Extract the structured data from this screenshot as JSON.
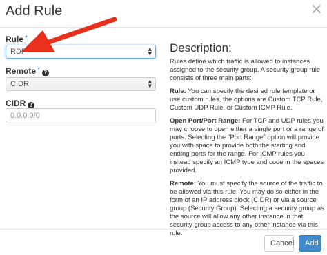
{
  "dialog": {
    "title": "Add Rule",
    "close_glyph": "×"
  },
  "form": {
    "rule": {
      "label": "Rule",
      "required_mark": "*",
      "value": "RDP"
    },
    "remote": {
      "label": "Remote",
      "required_mark": "*",
      "help_glyph": "?",
      "value": "CIDR"
    },
    "cidr": {
      "label": "CIDR",
      "help_glyph": "?",
      "placeholder": "0.0.0.0/0"
    }
  },
  "description": {
    "heading": "Description:",
    "intro": "Rules define which traffic is allowed to instances assigned to the security group. A security group rule consists of three main parts:",
    "rule_title": "Rule:",
    "rule_text": " You can specify the desired rule template or use custom rules, the options are Custom TCP Rule, Custom UDP Rule, or Custom ICMP Rule.",
    "port_title": "Open Port/Port Range:",
    "port_text": " For TCP and UDP rules you may choose to open either a single port or a range of ports. Selecting the \"Port Range\" option will provide you with space to provide both the starting and ending ports for the range. For ICMP rules you instead specify an ICMP type and code in the spaces provided.",
    "remote_title": "Remote:",
    "remote_text": " You must specify the source of the traffic to be allowed via this rule. You may do so either in the form of an IP address block (CIDR) or via a source group (Security Group). Selecting a security group as the source will allow any other instance in that security group access to any other instance via this rule."
  },
  "footer": {
    "cancel_label": "Cancel",
    "add_label": "Add"
  },
  "annotation": {
    "arrow_color": "#e8301c"
  },
  "colors": {
    "primary_button": "#428bca",
    "required_mark": "#1e73be",
    "focus_border": "#66afe9"
  }
}
